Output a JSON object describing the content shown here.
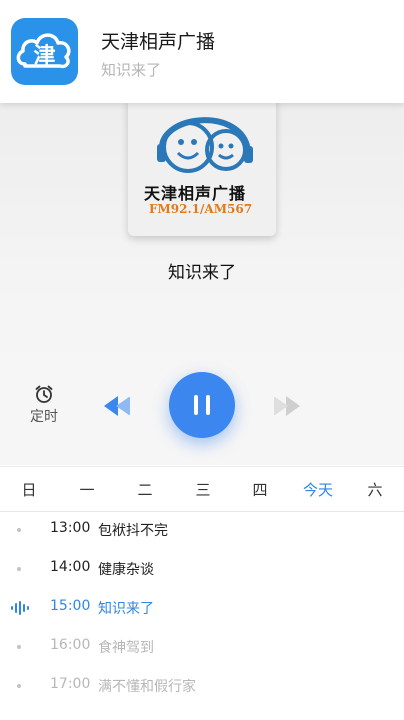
{
  "notification": {
    "app_icon_char": "津",
    "title": "天津相声广播",
    "subtitle": "知识来了"
  },
  "album": {
    "title": "天津相声广播",
    "freq": "FM92.1/AM567"
  },
  "player": {
    "song_title": "知识来了",
    "timer_label": "定时",
    "state": "playing",
    "accent_color": "#3b86ef"
  },
  "tabs": [
    "日",
    "一",
    "二",
    "三",
    "四",
    "今天",
    "六"
  ],
  "active_tab_index": 5,
  "schedule": [
    {
      "time": "13:00",
      "name": "包袱抖不完",
      "state": "past"
    },
    {
      "time": "14:00",
      "name": "健康杂谈",
      "state": "past"
    },
    {
      "time": "15:00",
      "name": "知识来了",
      "state": "current"
    },
    {
      "time": "16:00",
      "name": "食神驾到",
      "state": "future"
    },
    {
      "time": "17:00",
      "name": "满不懂和假行家",
      "state": "future"
    }
  ]
}
